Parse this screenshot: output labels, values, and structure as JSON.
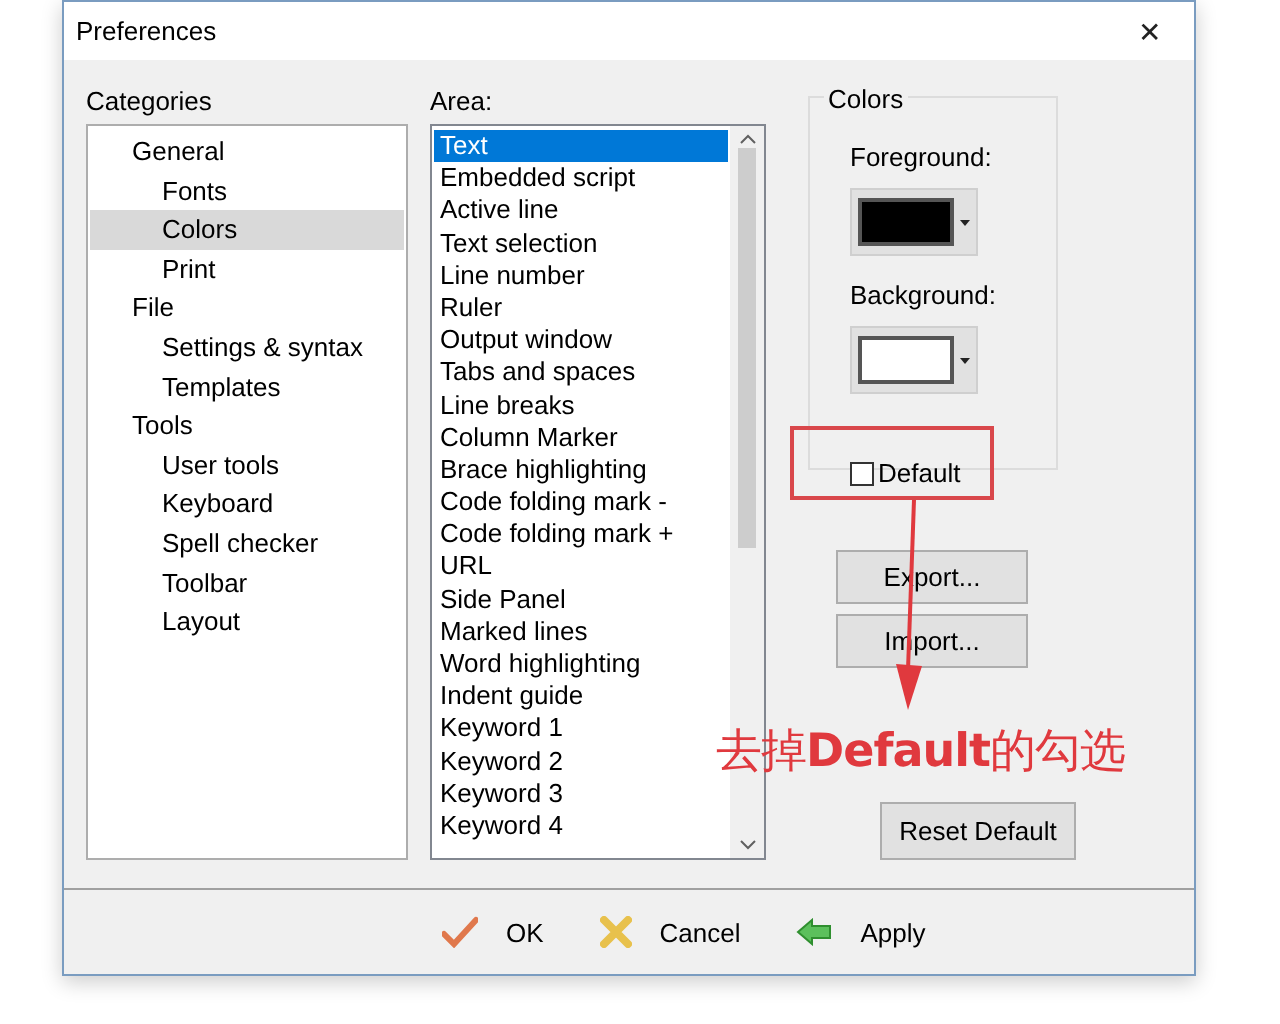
{
  "window": {
    "title": "Preferences",
    "close": "✕"
  },
  "categories": {
    "label": "Categories",
    "items": [
      {
        "label": "General",
        "selected": false,
        "children": [
          {
            "label": "Fonts",
            "selected": false
          },
          {
            "label": "Colors",
            "selected": true
          },
          {
            "label": "Print",
            "selected": false
          }
        ]
      },
      {
        "label": "File",
        "selected": false,
        "children": [
          {
            "label": "Settings & syntax",
            "selected": false
          },
          {
            "label": "Templates",
            "selected": false
          }
        ]
      },
      {
        "label": "Tools",
        "selected": false,
        "children": [
          {
            "label": "User tools",
            "selected": false
          },
          {
            "label": "Keyboard",
            "selected": false
          },
          {
            "label": "Spell checker",
            "selected": false
          },
          {
            "label": "Toolbar",
            "selected": false
          },
          {
            "label": "Layout",
            "selected": false
          }
        ]
      }
    ]
  },
  "area": {
    "label": "Area:",
    "items": [
      {
        "label": "Text",
        "selected": true
      },
      {
        "label": "Embedded script",
        "selected": false
      },
      {
        "label": "Active line",
        "selected": false
      },
      {
        "label": "Text selection",
        "selected": false
      },
      {
        "label": "Line number",
        "selected": false
      },
      {
        "label": "Ruler",
        "selected": false
      },
      {
        "label": "Output window",
        "selected": false
      },
      {
        "label": "Tabs and spaces",
        "selected": false
      },
      {
        "label": "Line breaks",
        "selected": false
      },
      {
        "label": "Column Marker",
        "selected": false
      },
      {
        "label": "Brace highlighting",
        "selected": false
      },
      {
        "label": "Code folding mark -",
        "selected": false
      },
      {
        "label": "Code folding mark +",
        "selected": false
      },
      {
        "label": "URL",
        "selected": false
      },
      {
        "label": "Side Panel",
        "selected": false
      },
      {
        "label": "Marked lines",
        "selected": false
      },
      {
        "label": "Word highlighting",
        "selected": false
      },
      {
        "label": "Indent guide",
        "selected": false
      },
      {
        "label": "Keyword 1",
        "selected": false
      },
      {
        "label": "Keyword 2",
        "selected": false
      },
      {
        "label": "Keyword 3",
        "selected": false
      },
      {
        "label": "Keyword 4",
        "selected": false
      }
    ]
  },
  "colors": {
    "title": "Colors",
    "foreground": {
      "label": "Foreground:",
      "color": "#000000"
    },
    "background": {
      "label": "Background:",
      "color": "#ffffff"
    },
    "default": {
      "label": "Default",
      "checked": false
    }
  },
  "side_buttons": [
    "Export...",
    "Import...",
    "Reset Default"
  ],
  "footer_buttons": [
    {
      "label": "OK",
      "kind": "ok"
    },
    {
      "label": "Cancel",
      "kind": "cancel"
    },
    {
      "label": "Apply",
      "kind": "apply"
    }
  ],
  "annotation": {
    "text": "去掉**Default**的勾选"
  }
}
